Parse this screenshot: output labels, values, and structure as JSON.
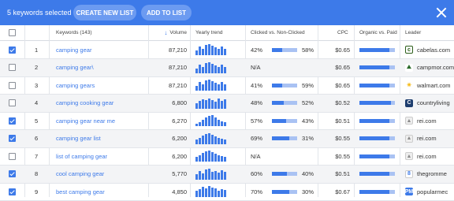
{
  "toolbar": {
    "selected_text": "5 keywords selected",
    "create_label": "CREATE NEW LIST",
    "add_label": "ADD TO LIST"
  },
  "headers": {
    "keywords": "Keywords (143)",
    "volume": "Volume",
    "trend": "Yearly trend",
    "clicked": "Clicked vs. Non-Clicked",
    "cpc": "CPC",
    "organic": "Organic vs. Paid",
    "leader": "Leader"
  },
  "colors": {
    "accent": "#3d7ae9",
    "bar_light": "#a9c2f3"
  },
  "rows": [
    {
      "num": "1",
      "keyword": "camping gear",
      "volume": "87,210",
      "checked": true,
      "clicked": "42%",
      "nonclicked": "58%",
      "clicked_frac": 0.42,
      "cpc": "$0.65",
      "organic_frac": 0.85,
      "leader": "cabelas.com",
      "icon": "cabelas-icon",
      "icon_char": "c",
      "icon_bg": "#ffffff",
      "icon_fg": "#2c5e1a",
      "icon_border": "#2c5e1a",
      "trend": [
        0.45,
        0.8,
        0.55,
        0.9,
        1.0,
        0.85,
        0.7,
        0.6,
        0.75,
        0.6
      ]
    },
    {
      "num": "2",
      "keyword": "camping gear\\",
      "volume": "87,210",
      "checked": false,
      "clicked": "N/A",
      "nonclicked": "",
      "clicked_frac": null,
      "cpc": "$0.65",
      "organic_frac": 0.85,
      "leader": "campmor.com",
      "icon": "campmor-icon",
      "icon_char": "⛰",
      "icon_bg": "#ffffff",
      "icon_fg": "#2a6b2a",
      "icon_border": "#ffffff",
      "trend": [
        0.45,
        0.8,
        0.55,
        0.9,
        1.0,
        0.85,
        0.7,
        0.6,
        0.75,
        0.6
      ]
    },
    {
      "num": "3",
      "keyword": "camping gears",
      "volume": "87,210",
      "checked": false,
      "clicked": "41%",
      "nonclicked": "59%",
      "clicked_frac": 0.41,
      "cpc": "$0.65",
      "organic_frac": 0.85,
      "leader": "walmart.com",
      "icon": "walmart-icon",
      "icon_char": "✳",
      "icon_bg": "#ffffff",
      "icon_fg": "#f5b400",
      "icon_border": "#ffffff",
      "trend": [
        0.45,
        0.8,
        0.55,
        0.9,
        1.0,
        0.85,
        0.7,
        0.6,
        0.75,
        0.6
      ]
    },
    {
      "num": "4",
      "keyword": "camping cooking gear",
      "volume": "6,800",
      "checked": false,
      "clicked": "48%",
      "nonclicked": "52%",
      "clicked_frac": 0.48,
      "cpc": "$0.52",
      "organic_frac": 0.88,
      "leader": "countryliving",
      "icon": "countryliving-icon",
      "icon_char": "C",
      "icon_bg": "#1d3d6e",
      "icon_fg": "#ffffff",
      "icon_border": "#1d3d6e",
      "trend": [
        0.5,
        0.7,
        0.85,
        0.75,
        0.95,
        0.8,
        0.65,
        0.9,
        0.7,
        0.85
      ]
    },
    {
      "num": "5",
      "keyword": "camping gear near me",
      "volume": "6,270",
      "checked": true,
      "clicked": "57%",
      "nonclicked": "43%",
      "clicked_frac": 0.57,
      "cpc": "$0.51",
      "organic_frac": 0.85,
      "leader": "rei.com",
      "icon": "rei-icon",
      "icon_char": "▲",
      "icon_bg": "#eeeeee",
      "icon_fg": "#8a8a8a",
      "icon_border": "#cccccc",
      "trend": [
        0.2,
        0.35,
        0.6,
        0.75,
        0.9,
        1.0,
        0.8,
        0.6,
        0.45,
        0.35
      ]
    },
    {
      "num": "6",
      "keyword": "camping gear list",
      "volume": "6,200",
      "checked": true,
      "clicked": "69%",
      "nonclicked": "31%",
      "clicked_frac": 0.69,
      "cpc": "$0.55",
      "organic_frac": 0.85,
      "leader": "rei.com",
      "icon": "rei-icon",
      "icon_char": "▲",
      "icon_bg": "#eeeeee",
      "icon_fg": "#8a8a8a",
      "icon_border": "#cccccc",
      "trend": [
        0.4,
        0.55,
        0.75,
        0.9,
        1.0,
        0.85,
        0.7,
        0.6,
        0.5,
        0.45
      ]
    },
    {
      "num": "7",
      "keyword": "list of camping gear",
      "volume": "6,200",
      "checked": false,
      "clicked": "N/A",
      "nonclicked": "",
      "clicked_frac": null,
      "cpc": "$0.55",
      "organic_frac": 0.85,
      "leader": "rei.com",
      "icon": "rei-icon",
      "icon_char": "▲",
      "icon_bg": "#eeeeee",
      "icon_fg": "#8a8a8a",
      "icon_border": "#cccccc",
      "trend": [
        0.4,
        0.55,
        0.75,
        0.9,
        1.0,
        0.85,
        0.7,
        0.6,
        0.5,
        0.45
      ]
    },
    {
      "num": "8",
      "keyword": "cool camping gear",
      "volume": "5,770",
      "checked": true,
      "clicked": "60%",
      "nonclicked": "40%",
      "clicked_frac": 0.6,
      "cpc": "$0.51",
      "organic_frac": 0.85,
      "leader": "thegromme",
      "icon": "thegrommet-icon",
      "icon_char": "8",
      "icon_bg": "#ffffff",
      "icon_fg": "#3d7ae9",
      "icon_border": "#cccccc",
      "trend": [
        0.5,
        0.75,
        0.6,
        0.9,
        1.0,
        0.7,
        0.8,
        0.65,
        0.85,
        0.7
      ]
    },
    {
      "num": "9",
      "keyword": "best camping gear",
      "volume": "4,850",
      "checked": true,
      "clicked": "70%",
      "nonclicked": "30%",
      "clicked_frac": 0.7,
      "cpc": "$0.67",
      "organic_frac": 0.85,
      "leader": "popularmec",
      "icon": "popularmechanics-icon",
      "icon_char": "PM",
      "icon_bg": "#3d7ae9",
      "icon_fg": "#ffffff",
      "icon_border": "#3d7ae9",
      "trend": [
        0.55,
        0.7,
        0.9,
        0.8,
        1.0,
        0.85,
        0.75,
        0.6,
        0.7,
        0.65
      ]
    }
  ]
}
